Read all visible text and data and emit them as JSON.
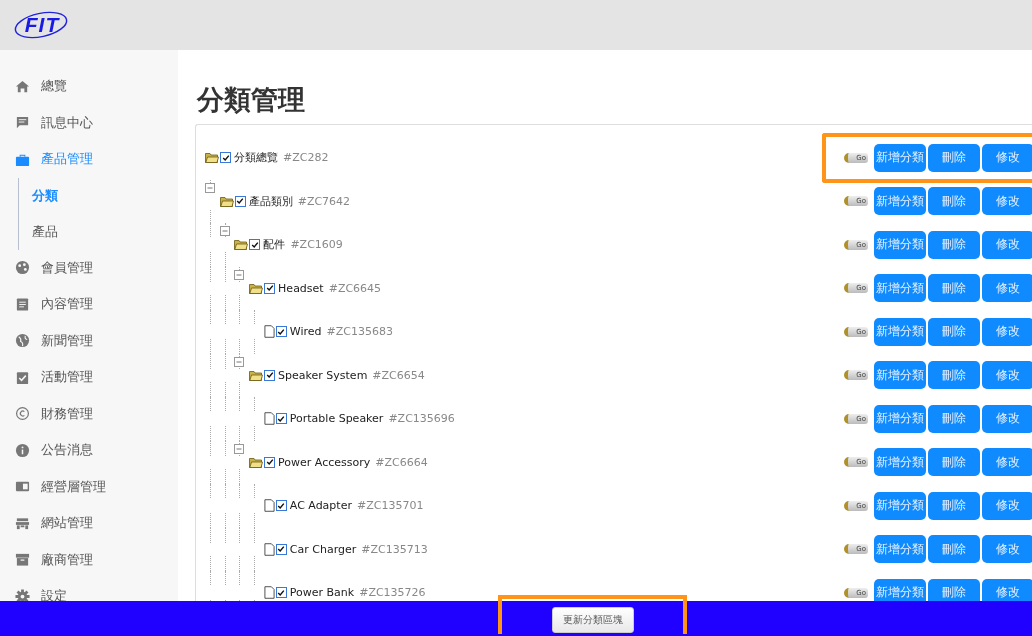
{
  "header": {
    "logo": "FIT"
  },
  "sidebar": {
    "items": [
      {
        "label": "總覽",
        "selected": false
      },
      {
        "label": "訊息中心",
        "selected": false
      },
      {
        "label": "產品管理",
        "selected": true,
        "children": [
          {
            "label": "分類",
            "selected": true
          },
          {
            "label": "產品",
            "selected": false
          }
        ]
      },
      {
        "label": "會員管理",
        "selected": false
      },
      {
        "label": "內容管理",
        "selected": false
      },
      {
        "label": "新聞管理",
        "selected": false
      },
      {
        "label": "活動管理",
        "selected": false
      },
      {
        "label": "財務管理",
        "selected": false
      },
      {
        "label": "公告消息",
        "selected": false
      },
      {
        "label": "經營層管理",
        "selected": false
      },
      {
        "label": "網站管理",
        "selected": false
      },
      {
        "label": "廠商管理",
        "selected": false
      },
      {
        "label": "設定",
        "selected": false
      }
    ]
  },
  "page": {
    "title": "分類管理"
  },
  "tree": [
    {
      "kind": "folder",
      "name": "分類總覽",
      "code": "#ZC282",
      "checked": true,
      "highlighted": true,
      "go": "Go",
      "actions": [
        "新增分類",
        "刪除",
        "修改"
      ],
      "children": [
        {
          "kind": "folder",
          "name": "產品類別",
          "code": "#ZC7642",
          "checked": true,
          "highlighted": false,
          "go": "Go",
          "actions": [
            "新增分類",
            "刪除",
            "修改"
          ],
          "children": [
            {
              "kind": "folder",
              "name": "配件",
              "code": "#ZC1609",
              "checked": true,
              "highlighted": false,
              "go": "Go",
              "actions": [
                "新增分類",
                "刪除",
                "修改"
              ],
              "children": [
                {
                  "kind": "folder",
                  "name": "Headset",
                  "code": "#ZC6645",
                  "checked": true,
                  "highlighted": false,
                  "go": "Go",
                  "actions": [
                    "新增分類",
                    "刪除",
                    "修改"
                  ],
                  "children": [
                    {
                      "kind": "file",
                      "name": "Wired",
                      "code": "#ZC135683",
                      "checked": true,
                      "highlighted": false,
                      "go": "Go",
                      "actions": [
                        "新增分類",
                        "刪除",
                        "修改"
                      ]
                    }
                  ]
                },
                {
                  "kind": "folder",
                  "name": "Speaker System",
                  "code": "#ZC6654",
                  "checked": true,
                  "highlighted": false,
                  "go": "Go",
                  "actions": [
                    "新增分類",
                    "刪除",
                    "修改"
                  ],
                  "children": [
                    {
                      "kind": "file",
                      "name": "Portable Speaker",
                      "code": "#ZC135696",
                      "checked": true,
                      "highlighted": false,
                      "go": "Go",
                      "actions": [
                        "新增分類",
                        "刪除",
                        "修改"
                      ]
                    }
                  ]
                },
                {
                  "kind": "folder",
                  "name": "Power Accessory",
                  "code": "#ZC6664",
                  "checked": true,
                  "highlighted": false,
                  "go": "Go",
                  "actions": [
                    "新增分類",
                    "刪除",
                    "修改"
                  ],
                  "children": [
                    {
                      "kind": "file",
                      "name": "AC Adapter",
                      "code": "#ZC135701",
                      "checked": true,
                      "highlighted": false,
                      "go": "Go",
                      "actions": [
                        "新增分類",
                        "刪除",
                        "修改"
                      ]
                    },
                    {
                      "kind": "file",
                      "name": "Car Charger",
                      "code": "#ZC135713",
                      "checked": true,
                      "highlighted": false,
                      "go": "Go",
                      "actions": [
                        "新增分類",
                        "刪除",
                        "修改"
                      ]
                    },
                    {
                      "kind": "file",
                      "name": "Power Bank",
                      "code": "#ZC135726",
                      "checked": true,
                      "highlighted": false,
                      "go": "Go",
                      "actions": [
                        "新增分類",
                        "刪除",
                        "修改"
                      ]
                    }
                  ]
                }
              ]
            }
          ]
        }
      ]
    }
  ],
  "footer": {
    "button": "更新分類區塊",
    "highlighted": true
  }
}
